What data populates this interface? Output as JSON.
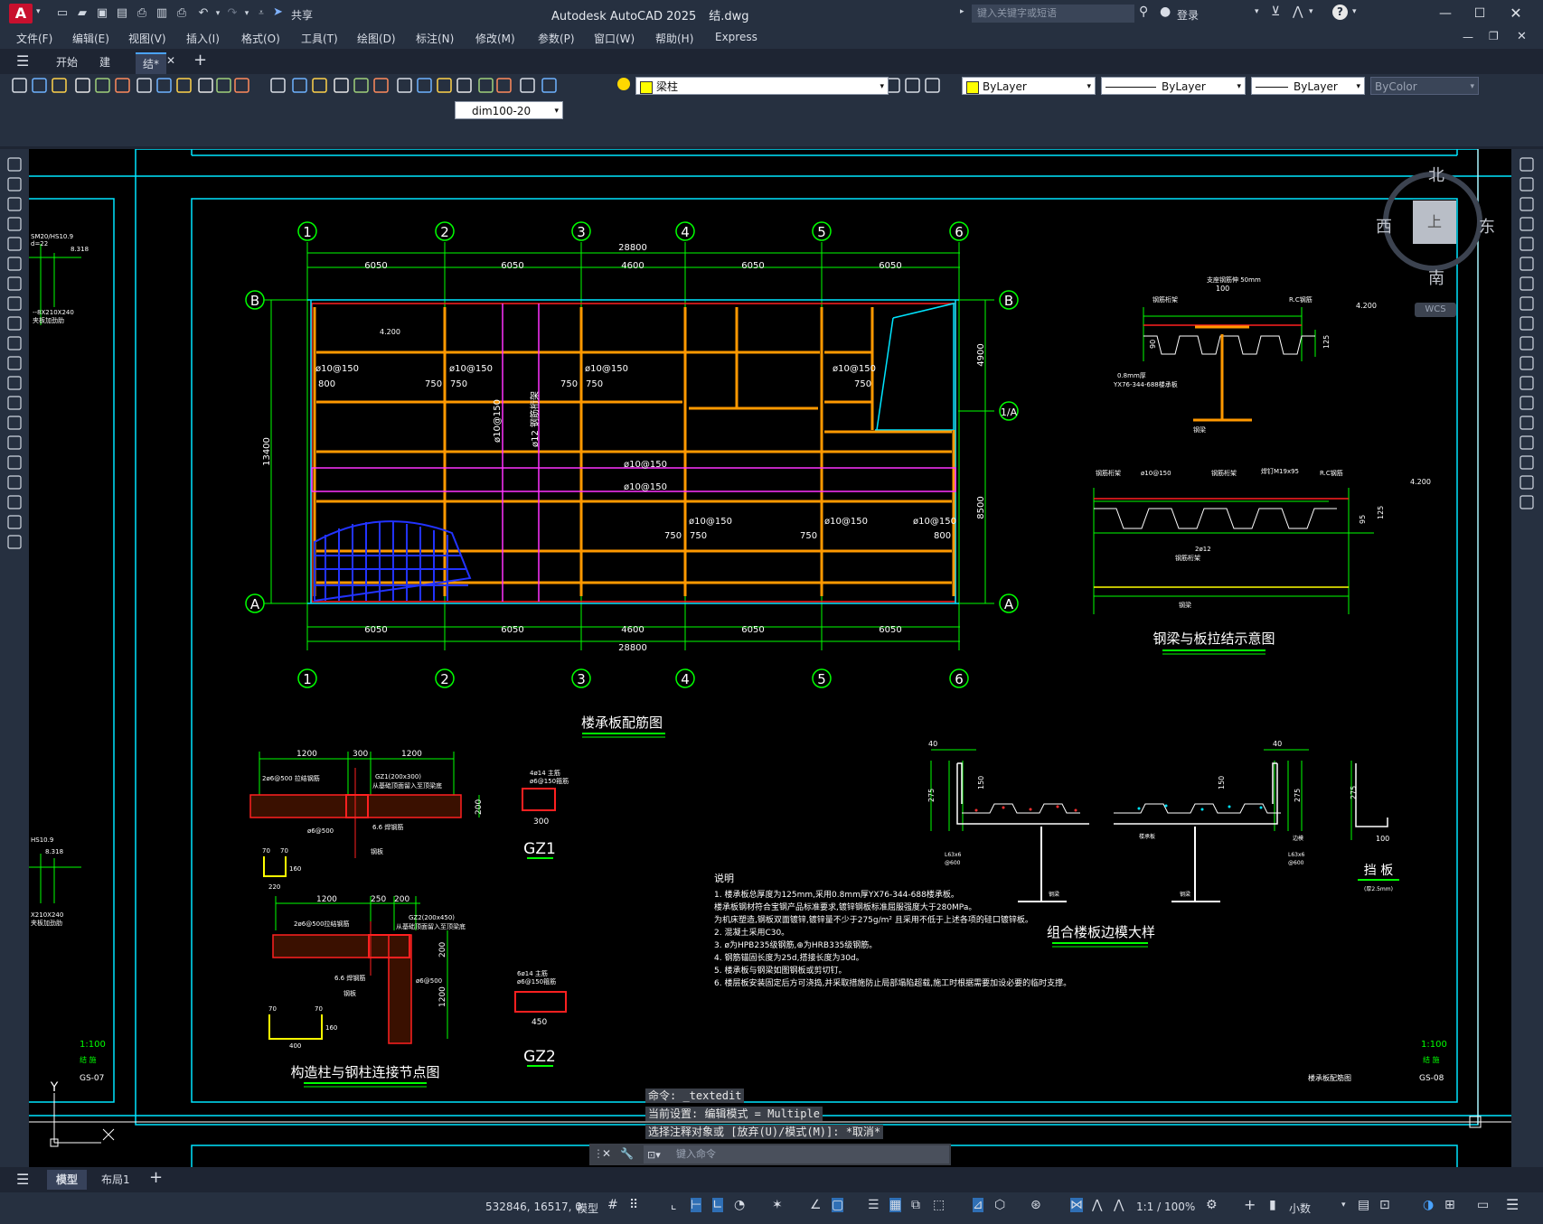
{
  "app": {
    "icon_letter": "A",
    "title": "Autodesk AutoCAD 2025",
    "document": "结.dwg",
    "share_label": "共享",
    "search_placeholder": "键入关键字或短语",
    "login_label": "登录"
  },
  "menu": [
    "文件(F)",
    "编辑(E)",
    "视图(V)",
    "插入(I)",
    "格式(O)",
    "工具(T)",
    "绘图(D)",
    "标注(N)",
    "修改(M)",
    "参数(P)",
    "窗口(W)",
    "帮助(H)",
    "Express"
  ],
  "tabs": [
    {
      "label": "开始"
    },
    {
      "label": "建"
    },
    {
      "label": "结*",
      "active": true
    }
  ],
  "toolbar": {
    "layer_value": "梁柱",
    "color_value": "ByLayer",
    "linetype_value": "ByLayer",
    "lineweight_value": "ByLayer",
    "plotstyle_value": "ByColor",
    "dimstyle_value": "dim100-20"
  },
  "viewcube": {
    "north": "北",
    "south": "南",
    "east": "东",
    "west": "西",
    "face": "上",
    "wcs": "WCS"
  },
  "drawing": {
    "axis_numbers": [
      "1",
      "2",
      "3",
      "4",
      "5",
      "6"
    ],
    "axis_letters": [
      "A",
      "B",
      "1/A"
    ],
    "total_dim": "28800",
    "bay_dims": [
      "6050",
      "6050",
      "4600",
      "6050",
      "6050"
    ],
    "vertical_dims": [
      "4900",
      "8500"
    ],
    "total_vertical": "13400",
    "elevation": "4.200",
    "rebar_labels": [
      "ø10@150",
      "ø10@150",
      "ø10@150",
      "ø10@150",
      "ø10@150",
      "ø10@150",
      "ø10@150",
      "ø10@150",
      "ø10@150"
    ],
    "rebar_spacings": [
      "800",
      "750",
      "750",
      "750",
      "750",
      "750",
      "750",
      "750",
      "750",
      "800"
    ],
    "vertical_rebar": [
      "ø10@150",
      "ø12 钢筋桁架"
    ],
    "plan_title": "楼承板配筋图",
    "beam_title": "钢梁与板拉结示意图",
    "edge_title": "组合楼板边模大样",
    "stop_title": "挡 板",
    "stop_note": "(厚2.5mm)",
    "node_title": "构造柱与钢柱连接节点图",
    "gz1": "GZ1",
    "gz2": "GZ2",
    "gz1_dims": [
      "1200",
      "300",
      "1200",
      "200",
      "300"
    ],
    "gz2_dims": [
      "1200",
      "250",
      "200",
      "200",
      "1200",
      "450"
    ],
    "c_dims": [
      "70",
      "70",
      "160",
      "220",
      "70",
      "70",
      "160",
      "400"
    ],
    "edge_dims": [
      "40",
      "275",
      "150",
      "40",
      "150",
      "275",
      "275",
      "100"
    ],
    "beam_dims": [
      "100",
      "90",
      "125",
      "4.200",
      "95",
      "125",
      "4.200"
    ],
    "notes_title": "说明",
    "notes": [
      "1. 楼承板总厚度为125mm,采用0.8mm厚YX76-344-688楼承板。",
      "   楼承板钢材符合宝钢产品标准要求,镀锌钢板标准屈服强度大于280MPa。",
      "   为机床塑造,钢板双面镀锌,镀锌量不少于275g/m² 且采用不低于上述各项的硅口镀锌板。",
      "2. 混凝土采用C30。",
      "3. ø为HPB235级钢筋,⊕为HRB335级钢筋。",
      "4. 钢筋锚固长度为25d,搭接长度为30d。",
      "5. 楼承板与钢梁如图钢板或剪切钉。",
      "6. 楼层板安装固定后方可浇捣,并采取措施防止局部塌陷超载,施工时根据需要加设必要的临时支撑。"
    ],
    "scale": "1:100",
    "sheet_label": "结 施",
    "sheet_no": "GS-08",
    "sheet_no_left": "GS-07",
    "sheet_name": "楼承板配筋图",
    "left_sheet_text": [
      "1:100",
      "结 施",
      "GS-07"
    ]
  },
  "command": {
    "history": [
      "命令: _textedit",
      "当前设置: 编辑模式 = Multiple",
      "选择注释对象或 [放弃(U)/模式(M)]: *取消*"
    ],
    "placeholder": "键入命令"
  },
  "layout_tabs": {
    "model": "模型",
    "layout1": "布局1"
  },
  "status": {
    "coords": "532846, 16517, 0",
    "model_label": "模型",
    "scale": "1:1 / 100%",
    "units": "小数"
  }
}
